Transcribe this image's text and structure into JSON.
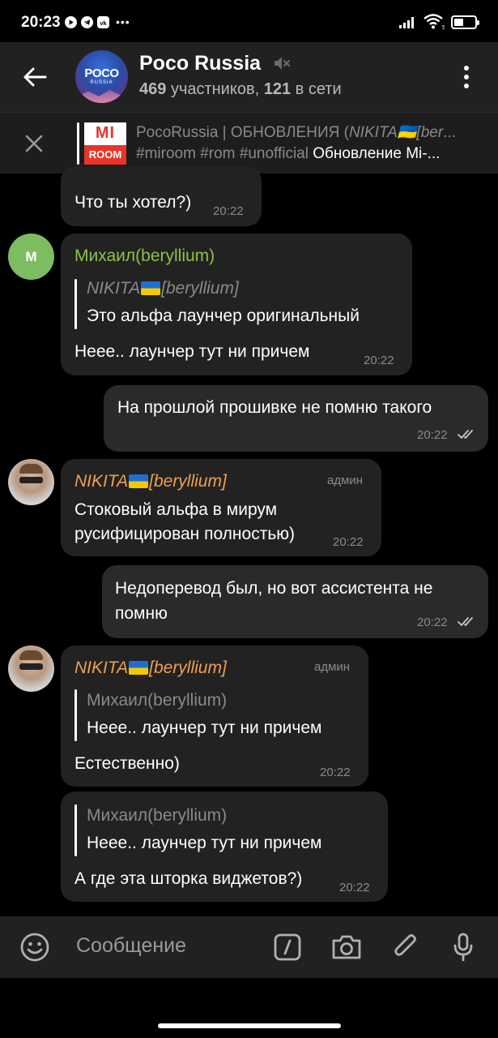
{
  "status_bar": {
    "time": "20:23",
    "battery_level": 0.45,
    "icons": [
      "play-icon",
      "telegram-icon",
      "vk-icon",
      "more-dots-icon",
      "signal-icon",
      "wifi-icon",
      "battery-icon"
    ],
    "more": "•••"
  },
  "header": {
    "title": "Poco Russia",
    "avatar_text": "POCO",
    "avatar_sub": "RUSSIA",
    "members_count": "469",
    "members_label": "участников,",
    "online_count": "121",
    "online_label": "в сети"
  },
  "pinned": {
    "thumb_top": "MI",
    "thumb_bottom": "ROOM",
    "title_prefix": "PocoRussia | ОБНОВЛЕНИЯ (",
    "title_italic": "NIKITA🇺🇦[ber",
    "title_ellipsis": "...",
    "tags": "#miroom #rom #unofficial ",
    "text_strong": "Обновление Mi-..."
  },
  "messages": [
    {
      "id": "m1",
      "text": "Что ты хотел?)",
      "time": "20:22"
    },
    {
      "id": "m2",
      "avatar_letter": "М",
      "sender": "Михаил(beryllium)",
      "reply_name_pre": "NIKITA",
      "reply_name_post": "[beryllium]",
      "reply_text": "Это альфа лаунчер оригинальный",
      "text": "Неее.. лаунчер тут ни причем",
      "time": "20:22"
    },
    {
      "id": "m3",
      "text": "На прошлой прошивке не помню такого",
      "time": "20:22",
      "outgoing": true
    },
    {
      "id": "m4",
      "sender_pre": "NIKITA",
      "sender_post": "[beryllium]",
      "badge": "админ",
      "text_line1": "Стоковый альфа в мирум",
      "text_line2": "русифицирован полностью)",
      "time": "20:22"
    },
    {
      "id": "m5",
      "text_line1": "Недоперевод был, но вот ассистента не",
      "text_line2": "помню",
      "time": "20:22",
      "outgoing": true
    },
    {
      "id": "m6",
      "sender_pre": "NIKITA",
      "sender_post": "[beryllium]",
      "badge": "админ",
      "reply_name": "Михаил(beryllium)",
      "reply_text": "Неее.. лаунчер тут ни причем",
      "text": "Естественно)",
      "time": "20:22"
    },
    {
      "id": "m7",
      "reply_name": "Михаил(beryllium)",
      "reply_text": "Неее.. лаунчер тут ни причем",
      "text": "А где эта шторка виджетов?)",
      "time": "20:22"
    }
  ],
  "input": {
    "placeholder": "Сообщение"
  },
  "colors": {
    "background": "#000000",
    "bubble": "#222222",
    "header": "#212121",
    "sender_green": "#8bc34a",
    "sender_orange": "#f0a050",
    "meta_gray": "#8a8a8a"
  }
}
